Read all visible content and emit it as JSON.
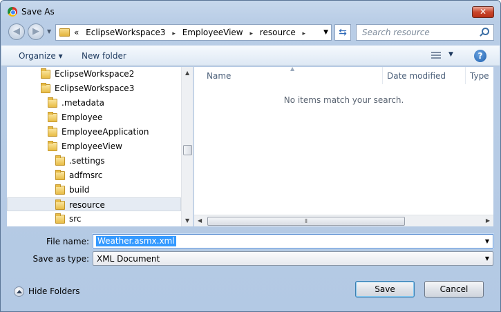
{
  "window": {
    "title": "Save As",
    "close_label": "✕"
  },
  "address": {
    "prefix": "«",
    "breadcrumbs": [
      "EclipseWorkspace3",
      "EmployeeView",
      "resource"
    ],
    "separator": "▸"
  },
  "search": {
    "placeholder": "Search resource"
  },
  "toolbar": {
    "organize_label": "Organize ▾",
    "new_folder_label": "New folder",
    "help_label": "?"
  },
  "tree": {
    "items": [
      {
        "label": "EclipseWorkspace2",
        "indent": 1,
        "selected": false
      },
      {
        "label": "EclipseWorkspace3",
        "indent": 1,
        "selected": false
      },
      {
        "label": ".metadata",
        "indent": 2,
        "selected": false
      },
      {
        "label": "Employee",
        "indent": 2,
        "selected": false
      },
      {
        "label": "EmployeeApplication",
        "indent": 2,
        "selected": false
      },
      {
        "label": "EmployeeView",
        "indent": 2,
        "selected": false
      },
      {
        "label": ".settings",
        "indent": 3,
        "selected": false
      },
      {
        "label": "adfmsrc",
        "indent": 3,
        "selected": false
      },
      {
        "label": "build",
        "indent": 3,
        "selected": false
      },
      {
        "label": "resource",
        "indent": 3,
        "selected": true
      },
      {
        "label": "src",
        "indent": 3,
        "selected": false
      }
    ]
  },
  "files": {
    "columns": [
      "Name",
      "Date modified",
      "Type"
    ],
    "empty_message": "No items match your search."
  },
  "form": {
    "filename_label": "File name:",
    "filename_value": "Weather.asmx.xml",
    "savetype_label": "Save as type:",
    "savetype_value": "XML Document"
  },
  "footer": {
    "hide_folders_label": "Hide Folders",
    "save_label": "Save",
    "cancel_label": "Cancel"
  }
}
